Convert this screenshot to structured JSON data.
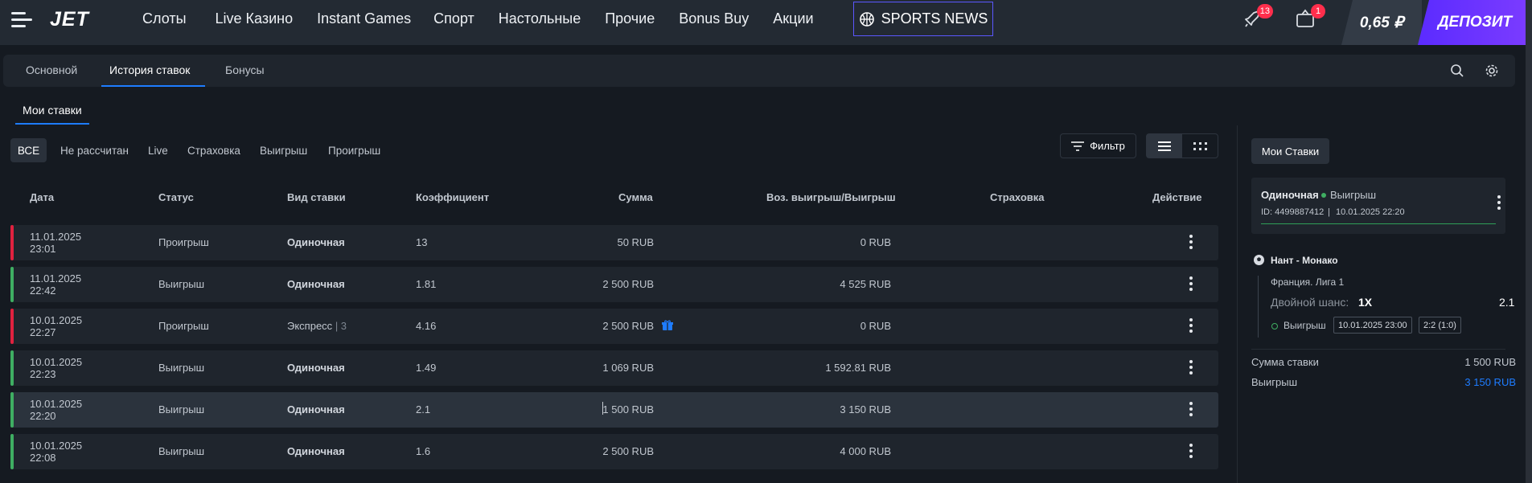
{
  "header": {
    "logo": "JET",
    "nav": [
      "Слоты",
      "Live Казино",
      "Instant Games",
      "Спорт",
      "Настольные",
      "Прочие",
      "Bonus Buy",
      "Акции"
    ],
    "sports_news": "SPORTS NEWS",
    "notifications_badge": "13",
    "bets_badge": "1",
    "balance": "0,65 ₽",
    "deposit_label": "ДЕПОЗИТ",
    "deposit_color": "#6a34ff"
  },
  "subtabs": [
    "Основной",
    "История ставок",
    "Бонусы"
  ],
  "section_tab": "Мои ставки",
  "filters": {
    "active": "ВСЕ",
    "chips": [
      "Не рассчитан",
      "Live",
      "Страховка",
      "Выигрыш",
      "Проигрыш"
    ],
    "filter_label": "Фильтр"
  },
  "table": {
    "headers": [
      "Дата",
      "Статус",
      "Вид ставки",
      "Коэффициент",
      "Сумма",
      "Воз. выигрыш/Выигрыш",
      "Страховка",
      "Действие"
    ],
    "rows": [
      {
        "date": "11.01.2025",
        "time": "23:01",
        "status": "Проигрыш",
        "type": "Одиночная",
        "count": "",
        "coef": "13",
        "sum": "50 RUB",
        "win": "0 RUB"
      },
      {
        "date": "11.01.2025",
        "time": "22:42",
        "status": "Выигрыш",
        "type": "Одиночная",
        "count": "",
        "coef": "1.81",
        "sum": "2 500 RUB",
        "win": "4 525 RUB"
      },
      {
        "date": "10.01.2025",
        "time": "22:27",
        "status": "Проигрыш",
        "type": "Экспресс",
        "count": "| 3",
        "coef": "4.16",
        "sum": "2 500 RUB",
        "win": "0 RUB"
      },
      {
        "date": "10.01.2025",
        "time": "22:23",
        "status": "Выигрыш",
        "type": "Одиночная",
        "count": "",
        "coef": "1.49",
        "sum": "1 069 RUB",
        "win": "1 592.81 RUB"
      },
      {
        "date": "10.01.2025",
        "time": "22:20",
        "status": "Выигрыш",
        "type": "Одиночная",
        "count": "",
        "coef": "2.1",
        "sum": "1 500 RUB",
        "win": "3 150 RUB"
      },
      {
        "date": "10.01.2025",
        "time": "22:08",
        "status": "Выигрыш",
        "type": "Одиночная",
        "count": "",
        "coef": "1.6",
        "sum": "2 500 RUB",
        "win": "4 000 RUB"
      }
    ],
    "status_colors": {
      "loss": "#e0223f",
      "win": "#3fae62"
    }
  },
  "panel": {
    "tab": "Мои Ставки",
    "bet_type": "Одиночная",
    "bet_status": "Выигрыш",
    "bet_id": "ID: 4499887412",
    "bet_datetime": "10.01.2025 22:20",
    "event": "Нант - Монако",
    "league": "Франция. Лига 1",
    "market": "Двойной шанс:",
    "selection": "1X",
    "odds": "2.1",
    "result": "Выигрыш",
    "event_time": "10.01.2025 23:00",
    "score": "2:2 (1:0)",
    "stake_label": "Сумма ставки",
    "stake_value": "1 500 RUB",
    "win_label": "Выигрыш",
    "win_value": "3 150 RUB",
    "win_color": "#1e7cff"
  }
}
